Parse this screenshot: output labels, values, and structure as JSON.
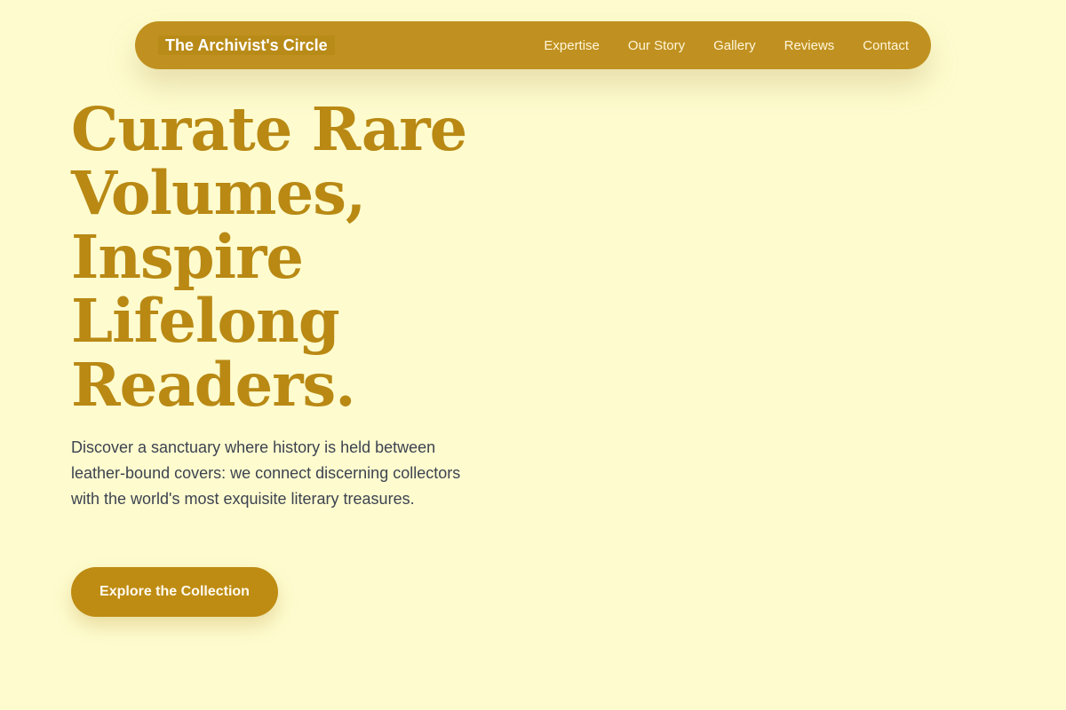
{
  "colors": {
    "page_background": "#fefccf",
    "nav_background": "#c09120",
    "brand_highlight": "#b88a17",
    "accent": "#b98914",
    "body_text": "#3d4350",
    "button_background": "#be8c12"
  },
  "nav": {
    "brand": "The Archivist's Circle",
    "links": [
      {
        "label": "Expertise"
      },
      {
        "label": "Our Story"
      },
      {
        "label": "Gallery"
      },
      {
        "label": "Reviews"
      },
      {
        "label": "Contact"
      }
    ]
  },
  "hero": {
    "title_lines": [
      "Curate Rare",
      "Volumes,",
      "Inspire",
      "Lifelong",
      "Readers."
    ],
    "description": "Discover a sanctuary where history is held between leather-bound covers: we connect discerning collectors with the world's most exquisite literary treasures.",
    "cta_label": "Explore the Collection"
  }
}
